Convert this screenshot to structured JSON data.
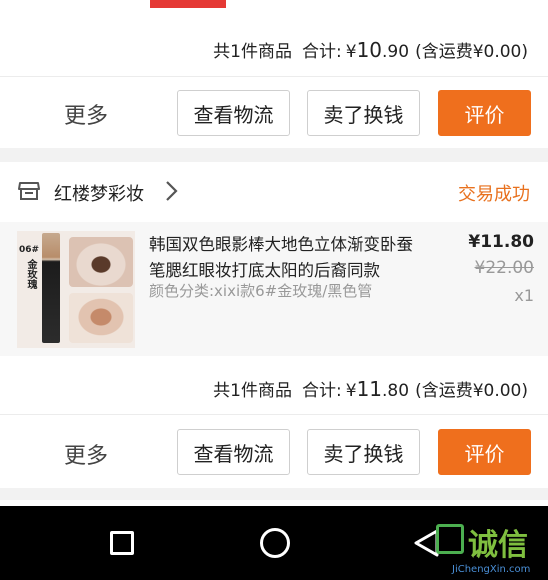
{
  "order_top": {
    "summary": {
      "count_text": "共1件商品",
      "total_label": "合计:",
      "currency": "¥",
      "amount_int": "10",
      "amount_dec": ".90",
      "shipping_text": "(含运费¥0.00)"
    },
    "actions": {
      "more_label": "更多",
      "logistics_label": "查看物流",
      "resell_label": "卖了换钱",
      "review_label": "评价"
    }
  },
  "order_bottom": {
    "shop_name": "红楼梦彩妆",
    "status": "交易成功",
    "product": {
      "title": "韩国双色眼影棒大地色立体渐变卧蚕笔腮红眼妆打底太阳的后裔同款",
      "variant": "颜色分类:xixi款6#金玫瑰/黑色管",
      "price": "¥11.80",
      "original_price": "¥22.00",
      "quantity": "x1",
      "image_label_num": "06#",
      "image_label_name": "金玫瑰"
    },
    "summary": {
      "count_text": "共1件商品",
      "total_label": "合计:",
      "currency": "¥",
      "amount_int": "11",
      "amount_dec": ".80",
      "shipping_text": "(含运费¥0.00)"
    },
    "actions": {
      "more_label": "更多",
      "logistics_label": "查看物流",
      "resell_label": "卖了换钱",
      "review_label": "评价"
    }
  },
  "watermark": {
    "brand": "诚信",
    "url": "JiChengXin.com"
  },
  "colors": {
    "accent": "#ef6f1d",
    "status": "#e8711e",
    "navbar": "#000000"
  },
  "icons": {
    "shop": "shop-icon",
    "chevron": "chevron-right-icon",
    "nav_recent": "square-icon",
    "nav_home": "circle-icon",
    "nav_back": "triangle-back-icon"
  }
}
